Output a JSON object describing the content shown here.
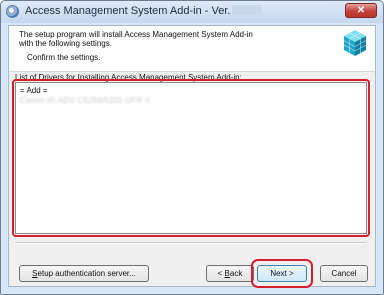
{
  "window": {
    "title": "Access Management System Add-in - Ver.",
    "close_label": "✕"
  },
  "header": {
    "line1": "The setup program will install Access Management System Add-in",
    "line2": "with the following settings.",
    "subtitle": "Confirm the settings."
  },
  "drivers": {
    "label": "List of Drivers for Installing Access Management System Add-in:",
    "list_title": "= Add =",
    "items": [
      "Canon iR-ADV C5250/5255 UFR II"
    ]
  },
  "buttons": {
    "setup_auth_u": "S",
    "setup_auth_rest": "etup authentication server...",
    "back_prefix": "< ",
    "back_u": "B",
    "back_rest": "ack",
    "next": "Next >",
    "cancel": "Cancel"
  },
  "colors": {
    "highlight": "#d51f2c",
    "title_bar": "#c5d8ef",
    "close_button": "#c4423a"
  },
  "icons": {
    "app": "setup-globe-icon",
    "product": "cube-stack-icon",
    "close": "close-icon"
  }
}
